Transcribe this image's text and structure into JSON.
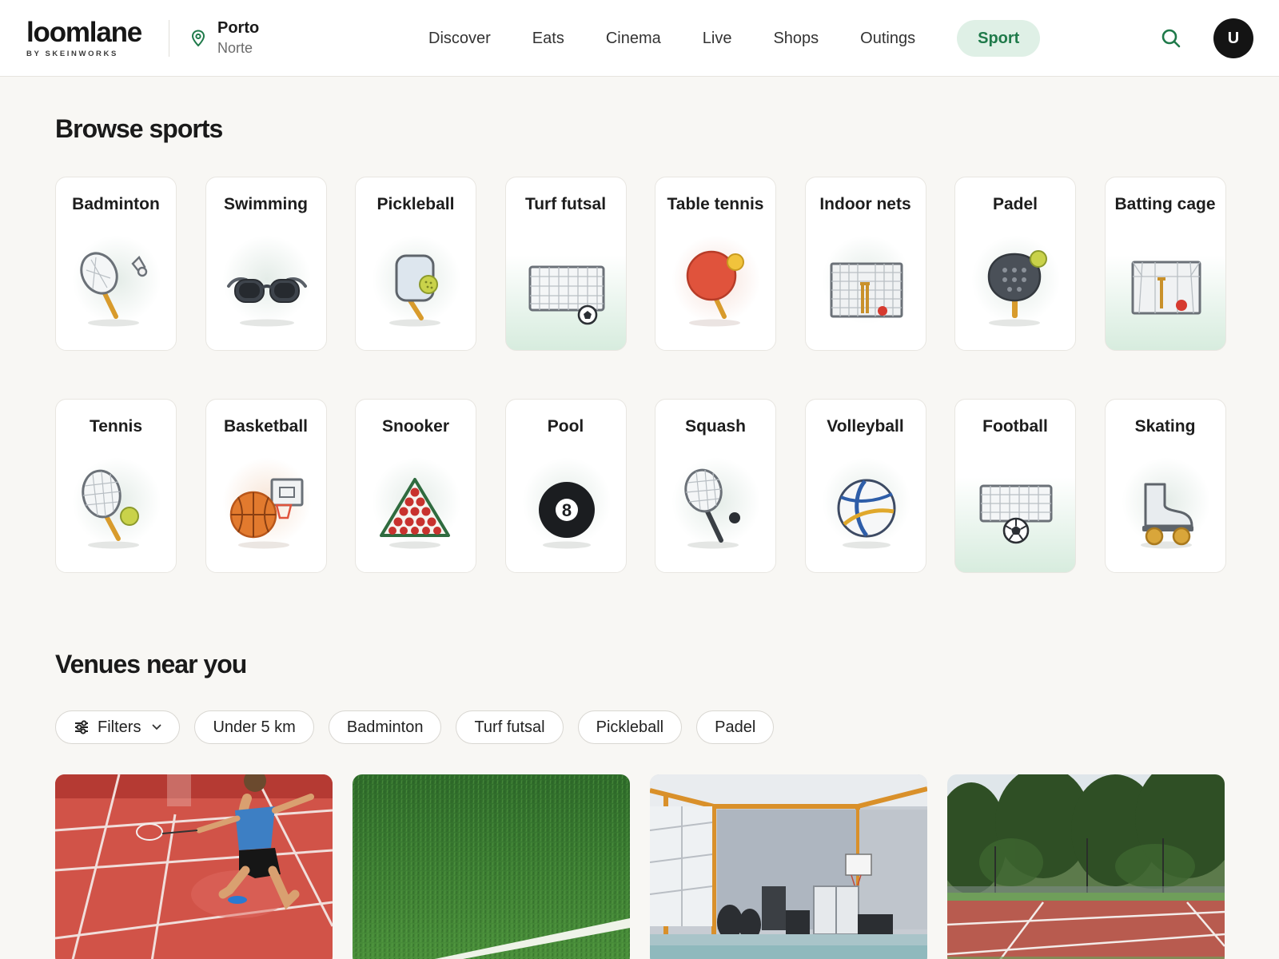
{
  "brand": {
    "name": "loomlane",
    "sub": "BY SKEINWORKS"
  },
  "location": {
    "city": "Porto",
    "region": "Norte",
    "icon": "map-pin-icon"
  },
  "nav": {
    "items": [
      {
        "label": "Discover"
      },
      {
        "label": "Eats"
      },
      {
        "label": "Cinema"
      },
      {
        "label": "Live"
      },
      {
        "label": "Shops"
      },
      {
        "label": "Outings"
      },
      {
        "label": "Sport",
        "active": true
      }
    ]
  },
  "header": {
    "search_icon": "search-icon",
    "avatar_initial": "U"
  },
  "browse": {
    "title": "Browse sports",
    "sports": [
      {
        "label": "Badminton",
        "icon": "badminton-icon"
      },
      {
        "label": "Swimming",
        "icon": "swimming-goggles-icon"
      },
      {
        "label": "Pickleball",
        "icon": "pickleball-paddle-icon"
      },
      {
        "label": "Turf futsal",
        "icon": "futsal-goal-icon",
        "highlight": "#d7ecde"
      },
      {
        "label": "Table tennis",
        "icon": "table-tennis-paddle-icon"
      },
      {
        "label": "Indoor nets",
        "icon": "cricket-nets-icon"
      },
      {
        "label": "Padel",
        "icon": "padel-racket-icon"
      },
      {
        "label": "Batting cage",
        "icon": "batting-cage-icon",
        "highlight": "#d7ecde"
      },
      {
        "label": "Tennis",
        "icon": "tennis-racket-icon"
      },
      {
        "label": "Basketball",
        "icon": "basketball-hoop-icon"
      },
      {
        "label": "Snooker",
        "icon": "snooker-triangle-icon"
      },
      {
        "label": "Pool",
        "icon": "eight-ball-icon",
        "ball_number": "8"
      },
      {
        "label": "Squash",
        "icon": "squash-racket-icon"
      },
      {
        "label": "Volleyball",
        "icon": "volleyball-icon"
      },
      {
        "label": "Football",
        "icon": "football-goal-icon",
        "highlight": "#d7ecde"
      },
      {
        "label": "Skating",
        "icon": "roller-skate-icon"
      }
    ]
  },
  "venues": {
    "title": "Venues near you",
    "filters": {
      "main": {
        "label": "Filters",
        "icon": "sliders-icon"
      },
      "chips": [
        "Under 5 km",
        "Badminton",
        "Turf futsal",
        "Pickleball",
        "Padel"
      ]
    },
    "cards": [
      {
        "image": "badminton-court-photo"
      },
      {
        "image": "turf-field-photo"
      },
      {
        "image": "indoor-sports-hall-photo"
      },
      {
        "image": "outdoor-tennis-court-photo"
      }
    ]
  },
  "colors": {
    "accent": "#1f7a4a",
    "accent_bg": "#dff0e6",
    "page_bg": "#f8f7f4"
  }
}
